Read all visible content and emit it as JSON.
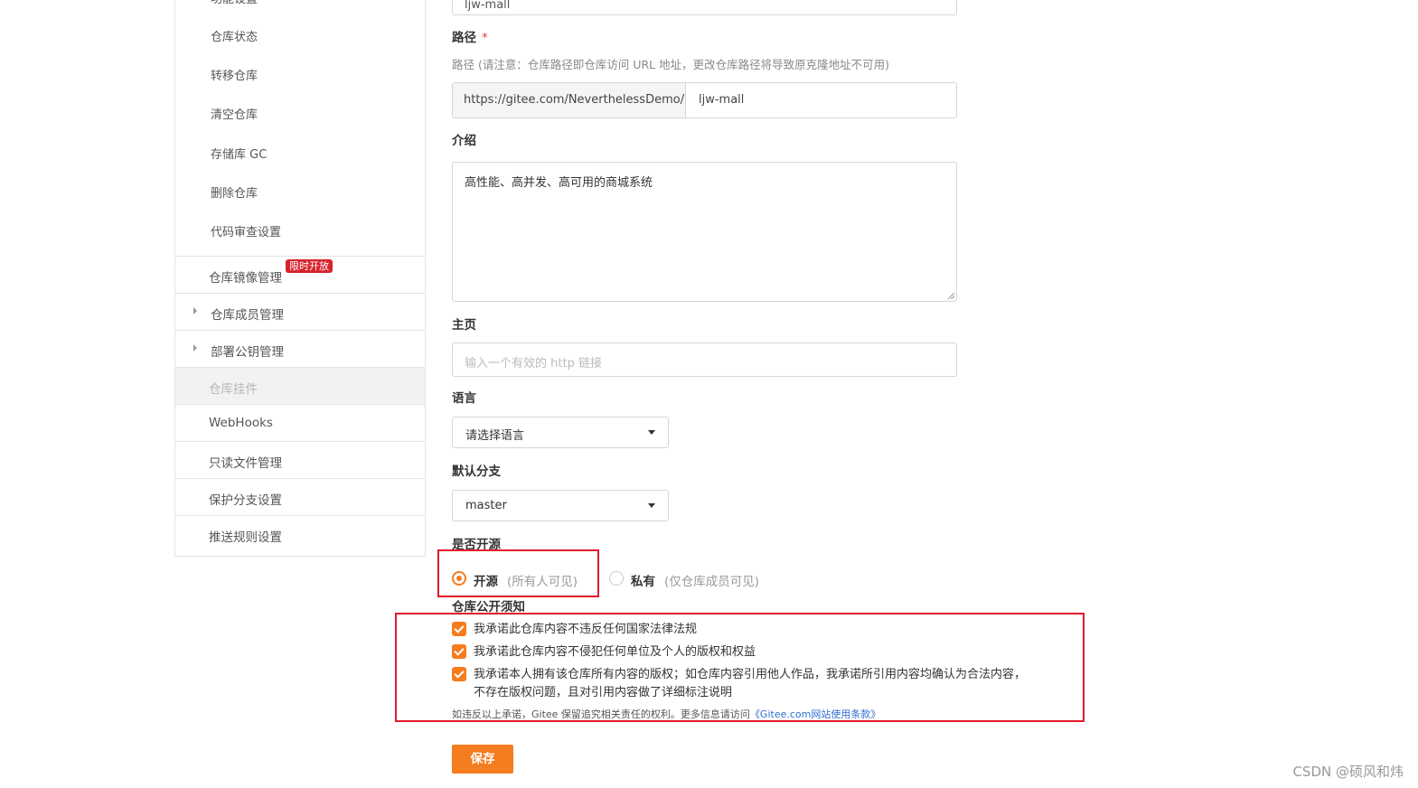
{
  "sidebar": {
    "sub_items": [
      {
        "label": "功能设置"
      },
      {
        "label": "仓库状态"
      },
      {
        "label": "转移仓库"
      },
      {
        "label": "清空仓库"
      },
      {
        "label": "存储库 GC"
      },
      {
        "label": "删除仓库"
      },
      {
        "label": "代码审查设置"
      }
    ],
    "groups": [
      {
        "label": "仓库镜像管理",
        "badge": "限时开放"
      },
      {
        "label": "仓库成员管理"
      },
      {
        "label": "部署公钥管理"
      },
      {
        "label": "仓库挂件"
      },
      {
        "label": "WebHooks"
      },
      {
        "label": "只读文件管理"
      },
      {
        "label": "保护分支设置"
      },
      {
        "label": "推送规则设置"
      }
    ]
  },
  "form": {
    "name_value": "ljw-mall",
    "path_label": "路径",
    "path_required": "*",
    "path_hint": "路径 (请注意：仓库路径即仓库访问 URL 地址，更改仓库路径将导致原克隆地址不可用)",
    "path_prefix": "https://gitee.com/NeverthelessDemo/",
    "path_value": "ljw-mall",
    "desc_label": "介绍",
    "desc_value": "高性能、高并发、高可用的商城系统",
    "homepage_label": "主页",
    "homepage_placeholder": "输入一个有效的 http 链接",
    "language_label": "语言",
    "language_value": "请选择语言",
    "branch_label": "默认分支",
    "branch_value": "master",
    "open_label": "是否开源",
    "radio_open": "开源",
    "radio_open_desc": "(所有人可见)",
    "radio_private": "私有",
    "radio_private_desc": "(仅仓库成员可见)",
    "notice_label": "仓库公开须知",
    "pledges": [
      "我承诺此仓库内容不违反任何国家法律法规",
      "我承诺此仓库内容不侵犯任何单位及个人的版权和权益",
      "我承诺本人拥有该仓库所有内容的版权；如仓库内容引用他人作品，我承诺所引用内容均确认为合法内容，",
      "不存在版权问题，且对引用内容做了详细标注说明"
    ],
    "notice_text": "如违反以上承诺，Gitee 保留追究相关责任的权利。更多信息请访问",
    "notice_link": "《Gitee.com网站使用条款》",
    "save_label": "保存"
  },
  "watermark": "CSDN @硕风和炜",
  "colors": {
    "accent": "#f57c1f",
    "highlight": "#e11b2a",
    "badge": "#d6232c",
    "link": "#2e6fd1"
  }
}
